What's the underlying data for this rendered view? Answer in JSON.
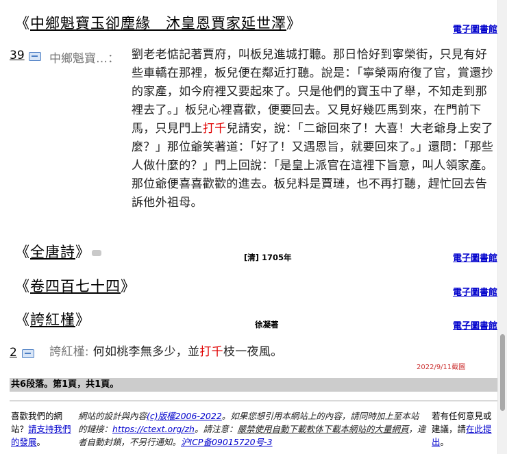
{
  "books": [
    {
      "title": "中鄉魁寶玉卻塵緣　沐皇恩賈家延世澤",
      "library_link": "電子圖書館"
    },
    {
      "title": "全唐詩",
      "meta": "[清] 1705年",
      "library_link": "電子圖書館"
    },
    {
      "title": "卷四百七十四",
      "library_link": "電子圖書館"
    },
    {
      "title": "誇紅槿",
      "meta": "徐凝著",
      "library_link": "電子圖書館"
    }
  ],
  "paragraphs": [
    {
      "number": "39",
      "source": "中鄉魁寶…：",
      "text_before": "劉老老惦記著賈府，叫板兒進城打聽。那日恰好到寧榮街，只見有好些車轎在那裡，板兒便在鄰近打聽。說是：「寧榮兩府復了官，賞還抄的家產，如今府裡又要起來了。只是他們的寶玉中了舉，不知走到那裡去了。」板兒心裡喜歡，便要回去。又見好幾匹馬到來，在門前下馬，只見門上",
      "highlight": "打千",
      "text_after": "兒請安，說：「二爺回來了！大喜！大老爺身上安了麼？」那位爺笑著道：「好了！又遇恩旨，就要回來了。」還問：「那些人做什麼的？」門上回說：「是皇上派官在這裡下旨意，叫人領家產。那位爺便喜喜歡歡的進去。板兒料是賈璉，也不再打聽，趕忙回去告訴他外祖母。"
    },
    {
      "number": "2",
      "source": "誇紅槿: ",
      "text_before": "何如桃李無多少，並",
      "highlight": "打千",
      "text_after": "枝一夜風。"
    }
  ],
  "snapshot_note": "2022/9/11截圖",
  "summary": {
    "part1": "共",
    "count": "6",
    "part2": "段落。第",
    "page": "1",
    "part3": "頁，共",
    "total": "1",
    "part4": "頁。"
  },
  "footer": {
    "left_text": "喜歡我們的網站？",
    "left_link": "請支持我們的發展",
    "left_end": "。",
    "mid_1": "網站的設計與內容",
    "mid_copyright": "(c)版權2006-2022",
    "mid_2": "。如果您想引用本網站上的內容，請同時加上至本站的鏈接：",
    "mid_url": "https://ctext.org/zh",
    "mid_3": "。請注意：",
    "mid_warning": "嚴禁使用自動下載軟体下載本網站的大量網頁",
    "mid_4": "，違者自動封鎖，不另行通知。",
    "mid_icp": "沪ICP备09015720号-3",
    "right_text": "若有任何意見或建議，請",
    "right_link": "在此提出",
    "right_end": "。"
  }
}
